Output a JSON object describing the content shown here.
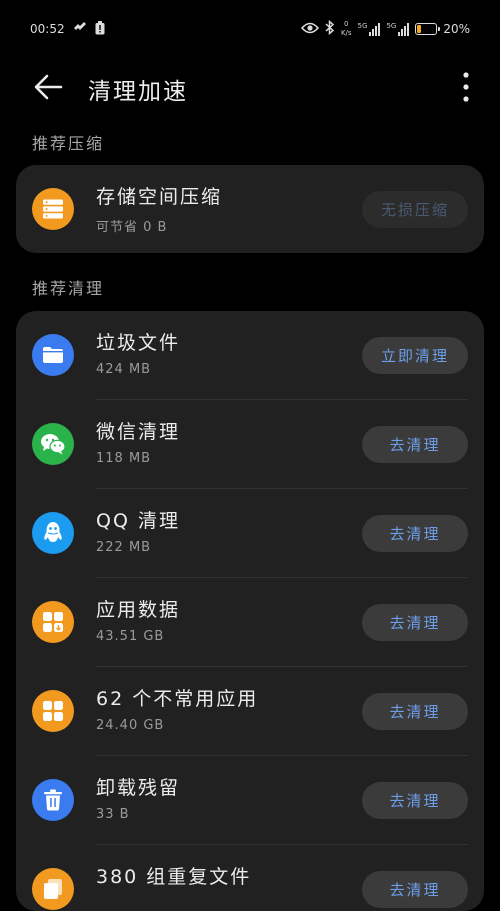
{
  "status_bar": {
    "time": "00:52",
    "speed_value": "0",
    "speed_unit": "K/s",
    "signal1": "5G",
    "signal2": "5G",
    "battery": "20%",
    "colors": {
      "battery_fill": "#f5a623"
    }
  },
  "header": {
    "title": "清理加速"
  },
  "sections": {
    "compress_title": "推荐压缩",
    "clean_title": "推荐清理"
  },
  "compress_item": {
    "title": "存储空间压缩",
    "subtitle": "可节省 0 B",
    "button": "无损压缩",
    "icon": "storage-icon",
    "icon_color": "#f29a20"
  },
  "clean_items": [
    {
      "title": "垃圾文件",
      "subtitle": "424 MB",
      "button": "立即清理",
      "icon": "folder-icon",
      "icon_color": "#3a7cf0"
    },
    {
      "title": "微信清理",
      "subtitle": "118 MB",
      "button": "去清理",
      "icon": "wechat-icon",
      "icon_color": "#2bb34b"
    },
    {
      "title": "QQ 清理",
      "subtitle": "222 MB",
      "button": "去清理",
      "icon": "qq-icon",
      "icon_color": "#1c9cf0"
    },
    {
      "title": "应用数据",
      "subtitle": "43.51 GB",
      "button": "去清理",
      "icon": "app-data-icon",
      "icon_color": "#f29a20"
    },
    {
      "title": "62 个不常用应用",
      "subtitle": "24.40 GB",
      "button": "去清理",
      "icon": "apps-grid-icon",
      "icon_color": "#f29a20"
    },
    {
      "title": "卸载残留",
      "subtitle": "33 B",
      "button": "去清理",
      "icon": "trash-icon",
      "icon_color": "#3a7cf0"
    },
    {
      "title": "380 组重复文件",
      "subtitle": "",
      "button": "去清理",
      "icon": "duplicate-files-icon",
      "icon_color": "#f29a20"
    }
  ]
}
